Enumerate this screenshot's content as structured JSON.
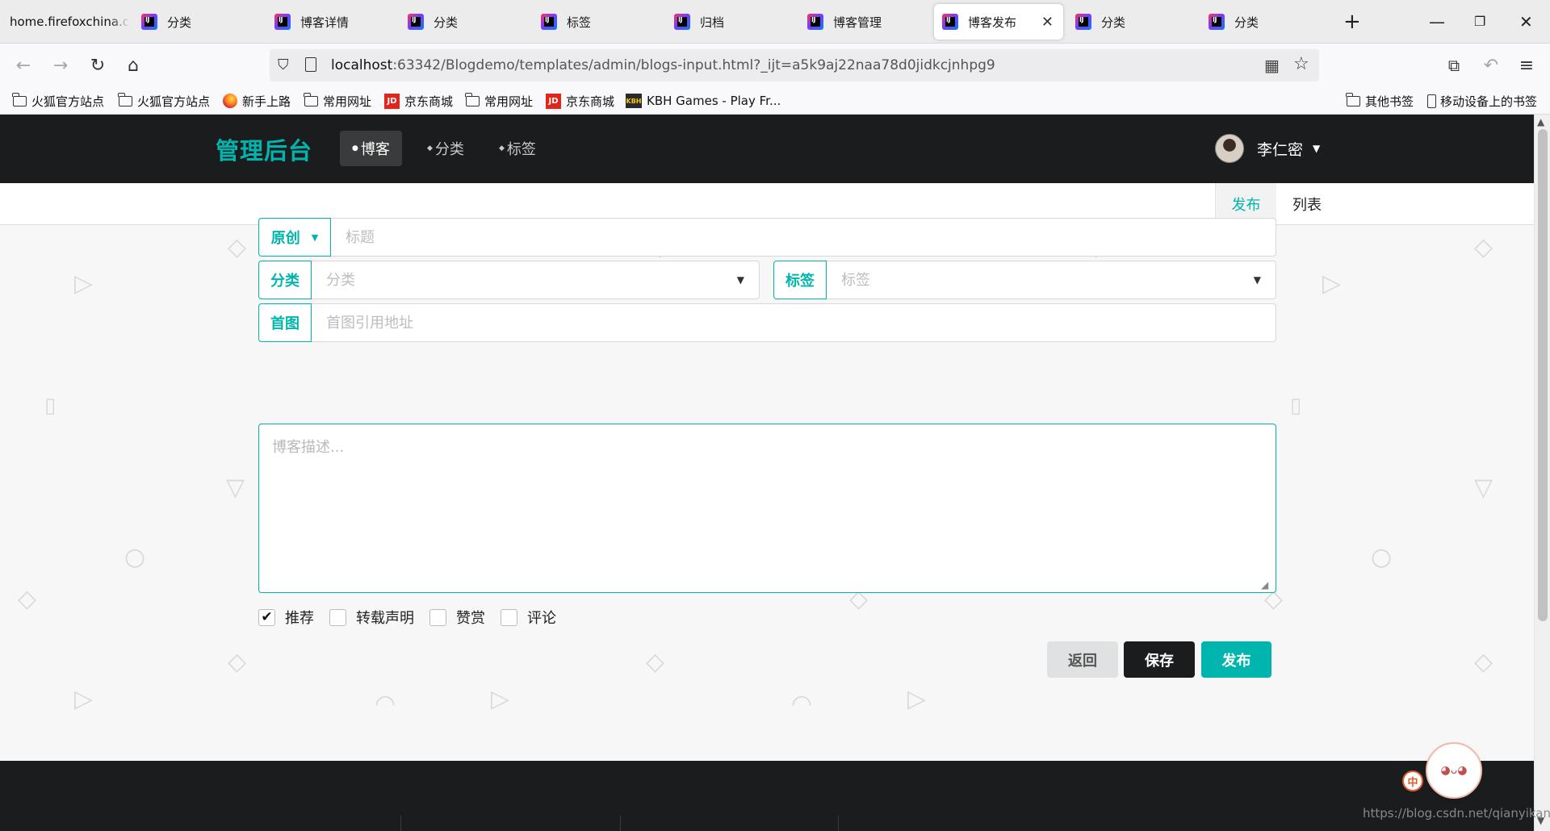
{
  "browser": {
    "tabs": [
      {
        "label": "home.firefoxchina.c",
        "icon": "page-icon"
      },
      {
        "label": "分类",
        "icon": "intellij-icon"
      },
      {
        "label": "博客详情",
        "icon": "intellij-icon"
      },
      {
        "label": "分类",
        "icon": "intellij-icon"
      },
      {
        "label": "标签",
        "icon": "intellij-icon"
      },
      {
        "label": "归档",
        "icon": "intellij-icon"
      },
      {
        "label": "博客管理",
        "icon": "intellij-icon"
      },
      {
        "label": "博客发布",
        "icon": "intellij-icon",
        "active": true
      },
      {
        "label": "分类",
        "icon": "intellij-icon"
      },
      {
        "label": "分类",
        "icon": "intellij-icon"
      }
    ],
    "url": {
      "host": "localhost",
      "rest": ":63342/Blogdemo/templates/admin/blogs-input.html?_ijt=a5k9aj22naa78d0jidkcjnhpg9"
    },
    "bookmarks": [
      "火狐官方站点",
      "火狐官方站点",
      "新手上路",
      "常用网址",
      "京东商城",
      "常用网址",
      "京东商城",
      "KBH Games - Play Fr..."
    ],
    "bookmarks_right": [
      "其他书签",
      "移动设备上的书签"
    ],
    "icon_text": {
      "jd": "JD",
      "kbh": "KBH"
    }
  },
  "site": {
    "brand": "管理后台",
    "nav": [
      "博客",
      "分类",
      "标签"
    ],
    "user": "李仁密",
    "subtabs": [
      "发布",
      "列表"
    ]
  },
  "form": {
    "type_label": "原创",
    "title_placeholder": "标题",
    "category_label": "分类",
    "category_placeholder": "分类",
    "tag_label": "标签",
    "tag_placeholder": "标签",
    "cover_label": "首图",
    "cover_placeholder": "首图引用地址",
    "desc_placeholder": "博客描述...",
    "checkboxes": [
      {
        "label": "推荐",
        "checked": true
      },
      {
        "label": "转载声明",
        "checked": false
      },
      {
        "label": "赞赏",
        "checked": false
      },
      {
        "label": "评论",
        "checked": false
      }
    ],
    "buttons": {
      "back": "返回",
      "save": "保存",
      "publish": "发布"
    }
  },
  "overlay": {
    "watermark": "https://blog.csdn.net/qianyikang",
    "zh_badge": "中"
  },
  "colors": {
    "accent": "#00b5ad",
    "dark": "#1b1c1d",
    "button_gray": "#e0e1e2"
  }
}
